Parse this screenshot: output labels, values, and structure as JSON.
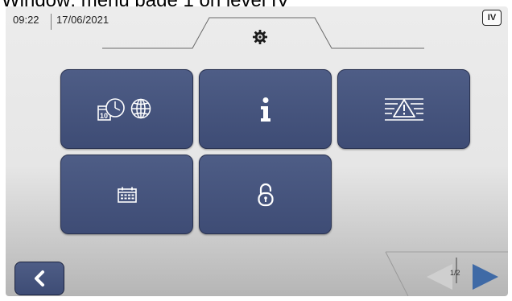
{
  "caption": "Window: menu page 1 on level IV",
  "header": {
    "time": "09:22",
    "date": "17/06/2021",
    "level": "IV",
    "active_tab_icon": "gear-icon"
  },
  "menu": {
    "tiles": [
      {
        "name": "tile-datetime-region",
        "icons": [
          "calendar-icon",
          "clock-icon",
          "globe-icon"
        ],
        "calendar_day": "10"
      },
      {
        "name": "tile-info",
        "icons": [
          "info-icon"
        ]
      },
      {
        "name": "tile-alarm-log",
        "icons": [
          "warning-list-icon"
        ]
      },
      {
        "name": "tile-calendar",
        "icons": [
          "calendar-icon"
        ]
      },
      {
        "name": "tile-unlock",
        "icons": [
          "unlock-icon"
        ]
      }
    ]
  },
  "footer": {
    "back_icon": "chevron-left-icon",
    "page_indicator": "1/2",
    "prev_icon": "triangle-left-icon",
    "next_icon": "triangle-right-icon",
    "prev_enabled": false,
    "next_enabled": true
  },
  "colors": {
    "tile": "#465580",
    "tile_border": "#2a3352",
    "next_arrow": "#3f6aa6",
    "prev_arrow_disabled": "#c8c8c8"
  }
}
